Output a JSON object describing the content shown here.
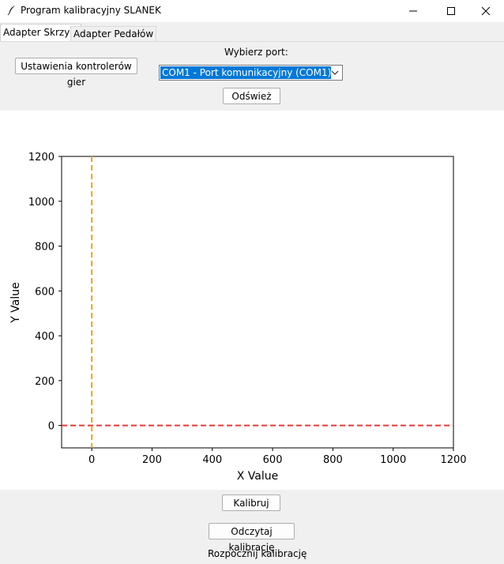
{
  "window": {
    "title": "Program kalibracyjny SLANEK"
  },
  "tabs": [
    {
      "label": "Adapter Skrzyni",
      "active": true
    },
    {
      "label": "Adapter Pedałów",
      "active": false
    }
  ],
  "controls": {
    "game_controllers_button": "Ustawienia kontrolerów gier",
    "port_label": "Wybierz port:",
    "port_selected": "COM1 - Port komunikacyjny (COM1)",
    "refresh_button": "Odśwież"
  },
  "chart_data": {
    "type": "line",
    "title": "",
    "xlabel": "X Value",
    "ylabel": "Y Value",
    "xlim": [
      -100,
      1200
    ],
    "ylim": [
      -100,
      1200
    ],
    "x_ticks": [
      0,
      200,
      400,
      600,
      800,
      1000,
      1200
    ],
    "y_ticks": [
      0,
      200,
      400,
      600,
      800,
      1000,
      1200
    ],
    "grid": false,
    "series": [
      {
        "style": "dashed",
        "color": "#e53935",
        "orientation": "horizontal",
        "y": 0
      },
      {
        "style": "dashed",
        "color": "#f0a020",
        "orientation": "vertical",
        "x": 0
      }
    ]
  },
  "bottom": {
    "calibrate_button": "Kalibruj",
    "read_calibration_button": "Odczytaj kalibrację",
    "status_text": "Rozpocznij kalibrację"
  }
}
